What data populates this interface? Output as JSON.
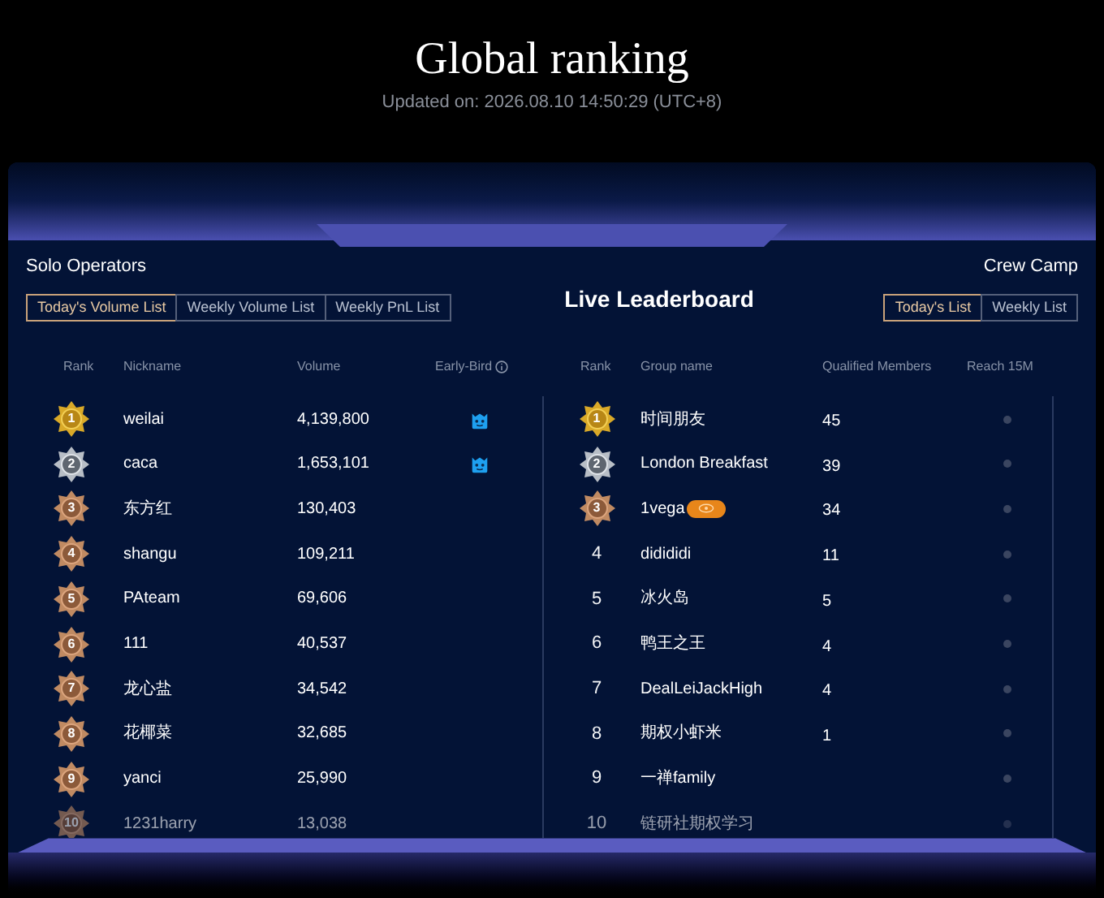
{
  "header": {
    "title": "Global ranking",
    "updated": "Updated on: 2026.08.10 14:50:29 (UTC+8)"
  },
  "board_title": "Live Leaderboard",
  "solo": {
    "title": "Solo Operators",
    "tabs": [
      {
        "label": "Today's Volume List",
        "selected": true
      },
      {
        "label": "Weekly Volume List",
        "selected": false
      },
      {
        "label": "Weekly PnL List",
        "selected": false
      }
    ],
    "columns": [
      "Rank",
      "Nickname",
      "Volume",
      "Early-Bird"
    ],
    "rows": [
      {
        "rank": "1",
        "kind": "gold",
        "nickname": "weilai",
        "volume": "4,139,800",
        "early_bird": true
      },
      {
        "rank": "2",
        "kind": "silver",
        "nickname": "caca",
        "volume": "1,653,101",
        "early_bird": true
      },
      {
        "rank": "3",
        "kind": "bronze",
        "nickname": "东方红",
        "volume": "130,403",
        "early_bird": false
      },
      {
        "rank": "4",
        "kind": "bronze",
        "nickname": "shangu",
        "volume": "109,211",
        "early_bird": false
      },
      {
        "rank": "5",
        "kind": "bronze",
        "nickname": "PAteam",
        "volume": "69,606",
        "early_bird": false
      },
      {
        "rank": "6",
        "kind": "bronze",
        "nickname": "111",
        "volume": "40,537",
        "early_bird": false
      },
      {
        "rank": "7",
        "kind": "bronze",
        "nickname": "龙心盐",
        "volume": "34,542",
        "early_bird": false
      },
      {
        "rank": "8",
        "kind": "bronze",
        "nickname": "花椰菜",
        "volume": "32,685",
        "early_bird": false
      },
      {
        "rank": "9",
        "kind": "bronze",
        "nickname": "yanci",
        "volume": "25,990",
        "early_bird": false
      },
      {
        "rank": "10",
        "kind": "bronze",
        "nickname": "1231harry",
        "volume": "13,038",
        "early_bird": false
      }
    ]
  },
  "crew": {
    "title": "Crew Camp",
    "tabs": [
      {
        "label": "Today's List",
        "selected": true
      },
      {
        "label": "Weekly List",
        "selected": false
      }
    ],
    "columns": [
      "Rank",
      "Group name",
      "Qualified Members",
      "Reach 15M"
    ],
    "rows": [
      {
        "rank": "1",
        "kind": "gold",
        "group": "时间朋友",
        "members": "45",
        "badge": false,
        "reached": false
      },
      {
        "rank": "2",
        "kind": "silver",
        "group": "London Breakfast",
        "members": "39",
        "badge": false,
        "reached": false
      },
      {
        "rank": "3",
        "kind": "bronze",
        "group": "1vega",
        "members": "34",
        "badge": true,
        "reached": false
      },
      {
        "rank": "4",
        "kind": "plain",
        "group": "didididi",
        "members": "11",
        "badge": false,
        "reached": false
      },
      {
        "rank": "5",
        "kind": "plain",
        "group": "冰火岛",
        "members": "5",
        "badge": false,
        "reached": false
      },
      {
        "rank": "6",
        "kind": "plain",
        "group": "鸭王之王",
        "members": "4",
        "badge": false,
        "reached": false
      },
      {
        "rank": "7",
        "kind": "plain",
        "group": "DealLeiJackHigh",
        "members": "4",
        "badge": false,
        "reached": false
      },
      {
        "rank": "8",
        "kind": "plain",
        "group": "期权小虾米",
        "members": "1",
        "badge": false,
        "reached": false
      },
      {
        "rank": "9",
        "kind": "plain",
        "group": "一禅family",
        "badge": false,
        "reached": false
      },
      {
        "rank": "10",
        "kind": "plain",
        "group": "链研社期权学习",
        "badge": false,
        "reached": false
      }
    ]
  }
}
